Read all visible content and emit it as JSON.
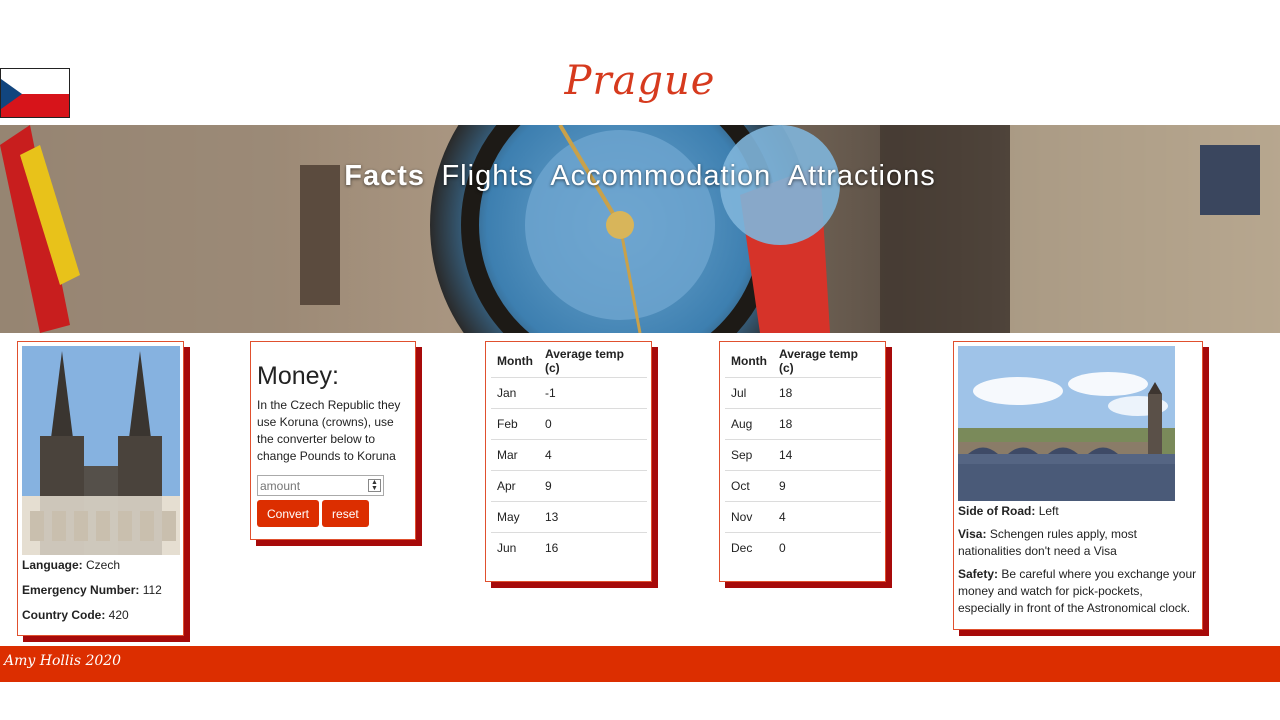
{
  "header": {
    "title": "Prague",
    "flag_icon": "czech-flag-icon"
  },
  "nav": {
    "items": [
      "Facts",
      "Flights",
      "Accommodation",
      "Attractions"
    ],
    "active": "Facts"
  },
  "facts_card": {
    "photo_icon": "church-photo",
    "language_label": "Language:",
    "language_value": "Czech",
    "emergency_label": "Emergency Number:",
    "emergency_value": "112",
    "country_code_label": "Country Code:",
    "country_code_value": "420"
  },
  "money_card": {
    "heading": "Money:",
    "description": "In the Czech Republic they use Koruna (crowns), use the converter below to change Pounds to Koruna",
    "amount_placeholder": "amount",
    "amount_value": "",
    "convert_label": "Convert",
    "reset_label": "reset"
  },
  "weather_1": {
    "col_month": "Month",
    "col_temp": "Average temp (c)",
    "rows": [
      {
        "month": "Jan",
        "temp": "-1"
      },
      {
        "month": "Feb",
        "temp": "0"
      },
      {
        "month": "Mar",
        "temp": "4"
      },
      {
        "month": "Apr",
        "temp": "9"
      },
      {
        "month": "May",
        "temp": "13"
      },
      {
        "month": "Jun",
        "temp": "16"
      }
    ]
  },
  "weather_2": {
    "col_month": "Month",
    "col_temp": "Average temp (c)",
    "rows": [
      {
        "month": "Jul",
        "temp": "18"
      },
      {
        "month": "Aug",
        "temp": "18"
      },
      {
        "month": "Sep",
        "temp": "14"
      },
      {
        "month": "Oct",
        "temp": "9"
      },
      {
        "month": "Nov",
        "temp": "4"
      },
      {
        "month": "Dec",
        "temp": "0"
      }
    ]
  },
  "travel_card": {
    "photo_icon": "river-bridge-photo",
    "road_label": "Side of Road:",
    "road_value": "Left",
    "visa_label": "Visa:",
    "visa_value": "Schengen rules apply, most nationalities don't need a Visa",
    "safety_label": "Safety:",
    "safety_value": "Be careful where you exchange your money and watch for pick-pockets, especially in front of the Astronomical clock."
  },
  "footer": {
    "text": "Amy Hollis 2020"
  },
  "colors": {
    "accent": "#dc2e00",
    "title": "#d63a1e",
    "card_shadow": "#a70a0a",
    "card_border": "#e0502e"
  }
}
